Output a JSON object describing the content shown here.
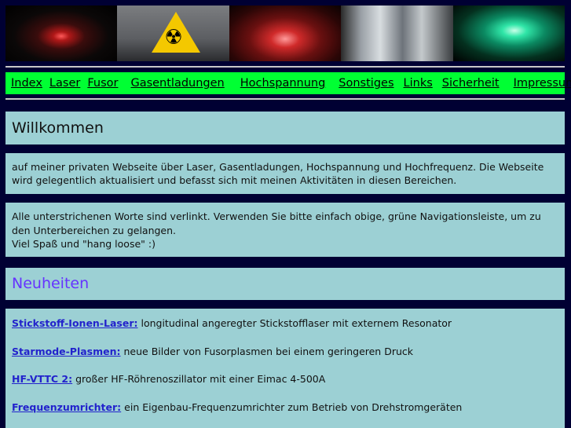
{
  "banner": {
    "images": [
      "laser-icon",
      "radiation-warning-icon",
      "plasma-icon",
      "vacuum-chamber-icon",
      "gas-discharge-tube-icon"
    ]
  },
  "nav": {
    "items": [
      "Index",
      "Laser",
      "Fusor",
      "Gasentladungen",
      "Hochspannung",
      "Sonstiges",
      "Links",
      "Sicherheit",
      "Impressum"
    ],
    "color": "#00ff33"
  },
  "welcome": {
    "title": "Willkommen",
    "intro": "auf meiner privaten Webseite über Laser, Gasentladungen, Hochspannung und Hochfrequenz. Die Webseite wird gelegentlich aktualisiert und befasst sich mit meinen Aktivitäten in diesen Bereichen.",
    "info_line1": "Alle unterstrichenen Worte sind verlinkt. Verwenden Sie bitte einfach obige, grüne Navigationsleiste, um zu den Unterbereichen zu gelangen.",
    "info_line2": "Viel Spaß und \"hang loose\" :)"
  },
  "news": {
    "title": "Neuheiten",
    "items": [
      {
        "link": "Stickstoff-Ionen-Laser:",
        "text": " longitudinal angeregter Stickstofflaser mit externem Resonator"
      },
      {
        "link": "Starmode-Plasmen:",
        "text": " neue Bilder von Fusorplasmen bei einem geringeren Druck"
      },
      {
        "link": "HF-VTTC 2:",
        "text": " großer HF-Röhrenoszillator mit einer Eimac 4-500A"
      },
      {
        "link": "Frequenzumrichter:",
        "text": " ein Eigenbau-Frequenzumrichter zum Betrieb von Drehstromgeräten"
      }
    ]
  }
}
